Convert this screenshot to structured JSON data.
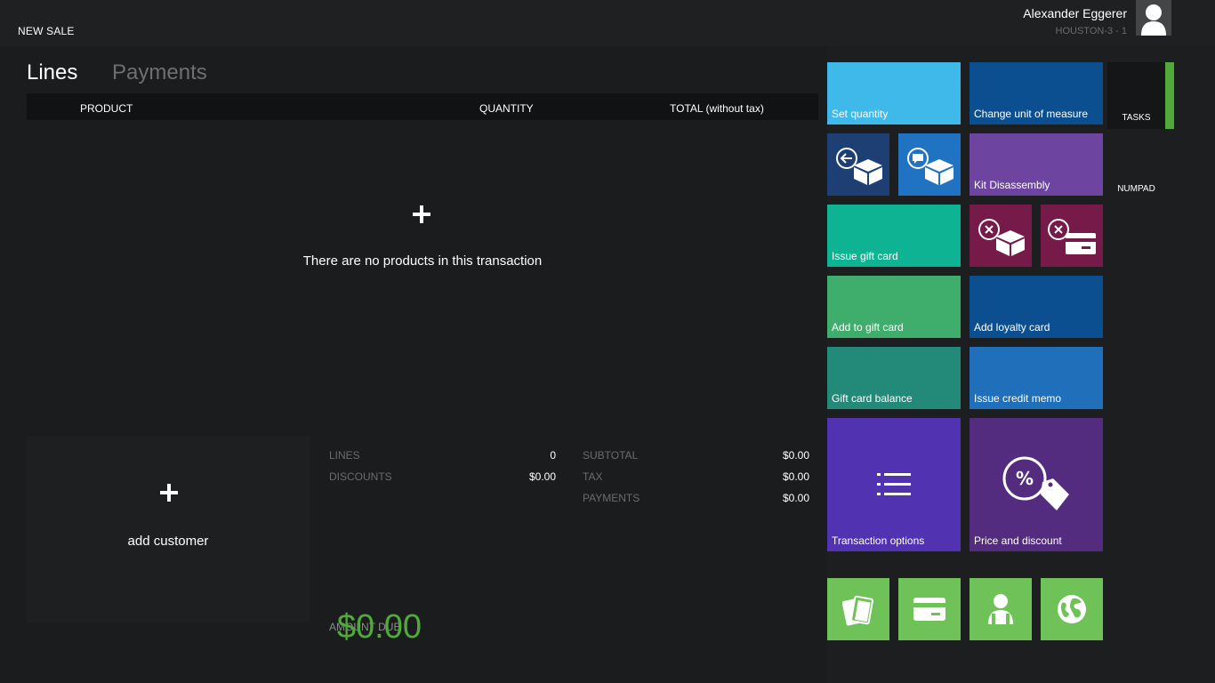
{
  "header": {
    "title": "NEW SALE",
    "user_name": "Alexander Eggerer",
    "register": "HOUSTON-3 - 1",
    "avatar_icon": "user-silhouette-icon"
  },
  "tabs": [
    {
      "label": "Lines",
      "active": true
    },
    {
      "label": "Payments",
      "active": false
    }
  ],
  "grid": {
    "columns": [
      "PRODUCT",
      "QUANTITY",
      "TOTAL (without tax)"
    ],
    "rows": [],
    "add_icon": "plus-icon",
    "empty_message": "There are no products in this transaction"
  },
  "customer": {
    "add_icon": "plus-icon",
    "label": "add customer"
  },
  "totals": {
    "lines_label": "LINES",
    "lines_value": "0",
    "discounts_label": "DISCOUNTS",
    "discounts_value": "$0.00",
    "subtotal_label": "SUBTOTAL",
    "subtotal_value": "$0.00",
    "tax_label": "TAX",
    "tax_value": "$0.00",
    "payments_label": "PAYMENTS",
    "payments_value": "$0.00",
    "amount_due_label": "AMOUNT DUE",
    "amount_due_value": "$0.00",
    "amount_due_color": "#52a93b"
  },
  "tiles": {
    "set_quantity": {
      "label": "Set quantity",
      "color": "#3fb8ea"
    },
    "change_uom": {
      "label": "Change unit of measure",
      "color": "#0c4f91"
    },
    "return_product": {
      "icon": "return-product-icon",
      "color": "#1d3f73"
    },
    "product_comment": {
      "icon": "product-comment-icon",
      "color": "#1f73c2"
    },
    "kit_disassembly": {
      "label": "Kit Disassembly",
      "color": "#6e44a1"
    },
    "issue_gift_card": {
      "label": "Issue gift card",
      "color": "#0db393"
    },
    "void_product": {
      "icon": "void-product-icon",
      "color": "#761a4a"
    },
    "void_payment": {
      "icon": "void-payment-icon",
      "color": "#761a4a"
    },
    "add_to_gift_card": {
      "label": "Add to gift card",
      "color": "#3fad6c"
    },
    "add_loyalty_card": {
      "label": "Add loyalty card",
      "color": "#0c4f91"
    },
    "gift_card_balance": {
      "label": "Gift card balance",
      "color": "#238a79"
    },
    "issue_credit_memo": {
      "label": "Issue credit memo",
      "color": "#1f6fba"
    },
    "transaction_options": {
      "label": "Transaction options",
      "icon": "list-icon",
      "color": "#5133b1"
    },
    "price_and_discount": {
      "label": "Price and discount",
      "icon": "percent-tag-icon",
      "color": "#532b7f"
    },
    "pay_cash": {
      "icon": "cash-icon",
      "color": "#6fc258"
    },
    "pay_card": {
      "icon": "credit-card-icon",
      "color": "#6fc258"
    },
    "pay_customer_account": {
      "icon": "customer-account-icon",
      "color": "#6fc258"
    },
    "pay_currency": {
      "icon": "globe-icon",
      "color": "#6fc258"
    }
  },
  "side": {
    "tasks_label": "TASKS",
    "numpad_label": "NUMPAD",
    "accent_color": "#52a93b"
  }
}
